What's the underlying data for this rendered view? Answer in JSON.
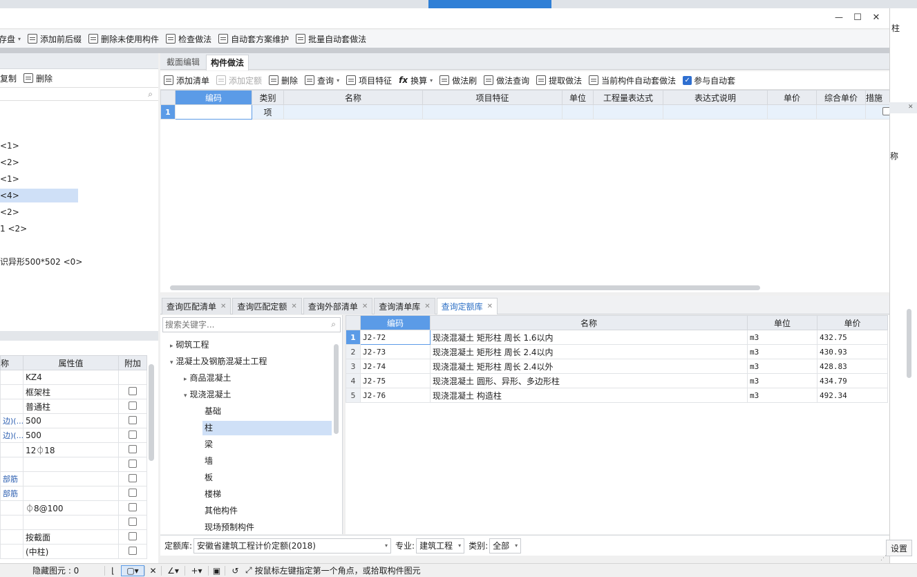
{
  "main_toolbar": {
    "items": [
      "存盘",
      "添加前后缀",
      "删除未使用构件",
      "检查做法",
      "自动套方案维护",
      "批量自动套做法"
    ]
  },
  "left_panel": {
    "toolbar": [
      "复制",
      "删除"
    ],
    "tree_items": [
      "<1>",
      "<2>",
      "<1>",
      "<4>",
      "<2>",
      "1 <2>",
      "识异形500*502 <0>"
    ],
    "props_header": [
      "称",
      "属性值",
      "附加"
    ],
    "props_rows": [
      {
        "name": "",
        "value": "KZ4"
      },
      {
        "name": "",
        "value": "框架柱"
      },
      {
        "name": "",
        "value": "普通柱"
      },
      {
        "name": "边)(...",
        "value": "500"
      },
      {
        "name": "边)(...",
        "value": "500"
      },
      {
        "name": "",
        "value": "12⏀18"
      },
      {
        "name": "",
        "value": ""
      },
      {
        "name": "部筋",
        "value": ""
      },
      {
        "name": "部筋",
        "value": ""
      },
      {
        "name": "",
        "value": "⏀8@100"
      },
      {
        "name": "",
        "value": ""
      },
      {
        "name": "",
        "value": "按截面"
      },
      {
        "name": "",
        "value": "(中柱)"
      }
    ]
  },
  "dialog": {
    "title_buttons": {
      "minimize": "—",
      "maximize": "☐",
      "close": "✕"
    },
    "tabs": [
      "截面编辑",
      "构件做法"
    ],
    "active_tab": 1,
    "toolbar": [
      "添加清单",
      "添加定额",
      "删除",
      "查询",
      "项目特征",
      "换算",
      "做法刷",
      "做法查询",
      "提取做法",
      "当前构件自动套做法",
      "参与自动套"
    ],
    "grid_headers": [
      "编码",
      "类别",
      "名称",
      "项目特征",
      "单位",
      "工程量表达式",
      "表达式说明",
      "单价",
      "综合单价",
      "措施"
    ],
    "grid_rows": [
      {
        "no": "1",
        "code": "",
        "type": "项"
      }
    ],
    "bottom_tabs": [
      "查询匹配清单",
      "查询匹配定额",
      "查询外部清单",
      "查询清单库",
      "查询定额库"
    ],
    "bottom_active": 4,
    "search_placeholder": "搜索关键字...",
    "tree": [
      {
        "label": "砌筑工程",
        "level": 0,
        "arrow": "▸"
      },
      {
        "label": "混凝土及钢筋混凝土工程",
        "level": 0,
        "arrow": "▾"
      },
      {
        "label": "商品混凝土",
        "level": 1,
        "arrow": "▸"
      },
      {
        "label": "现浇混凝土",
        "level": 1,
        "arrow": "▾"
      },
      {
        "label": "基础",
        "level": 2,
        "arrow": ""
      },
      {
        "label": "柱",
        "level": 2,
        "arrow": "",
        "selected": true
      },
      {
        "label": "梁",
        "level": 2,
        "arrow": ""
      },
      {
        "label": "墙",
        "level": 2,
        "arrow": ""
      },
      {
        "label": "板",
        "level": 2,
        "arrow": ""
      },
      {
        "label": "楼梯",
        "level": 2,
        "arrow": ""
      },
      {
        "label": "其他构件",
        "level": 2,
        "arrow": ""
      },
      {
        "label": "现场预制构件",
        "level": 2,
        "arrow": ""
      }
    ],
    "quota_headers": [
      "编码",
      "名称",
      "单位",
      "单价"
    ],
    "quota_rows": [
      {
        "no": "1",
        "code": "J2-72",
        "name": "现浇混凝土 矩形柱 周长 1.6以内",
        "unit": "m3",
        "price": "432.75"
      },
      {
        "no": "2",
        "code": "J2-73",
        "name": "现浇混凝土 矩形柱 周长 2.4以内",
        "unit": "m3",
        "price": "430.93"
      },
      {
        "no": "3",
        "code": "J2-74",
        "name": "现浇混凝土 矩形柱 周长 2.4以外",
        "unit": "m3",
        "price": "428.83"
      },
      {
        "no": "4",
        "code": "J2-75",
        "name": "现浇混凝土 圆形、异形、多边形柱",
        "unit": "m3",
        "price": "434.79"
      },
      {
        "no": "5",
        "code": "J2-76",
        "name": "现浇混凝土 构造柱",
        "unit": "m3",
        "price": "492.34"
      }
    ],
    "footer": {
      "lib_label": "定额库:",
      "lib_value": "安徽省建筑工程计价定额(2018)",
      "major_label": "专业:",
      "major_value": "建筑工程",
      "type_label": "类别:",
      "type_value": "全部"
    }
  },
  "right_panel": {
    "col_label": "称",
    "top_label": "柱",
    "settings": "设置"
  },
  "status_bar": {
    "hidden_label": "隐藏图元 : 0",
    "hint": "按鼠标左键指定第一个角点，或拾取构件图元"
  }
}
